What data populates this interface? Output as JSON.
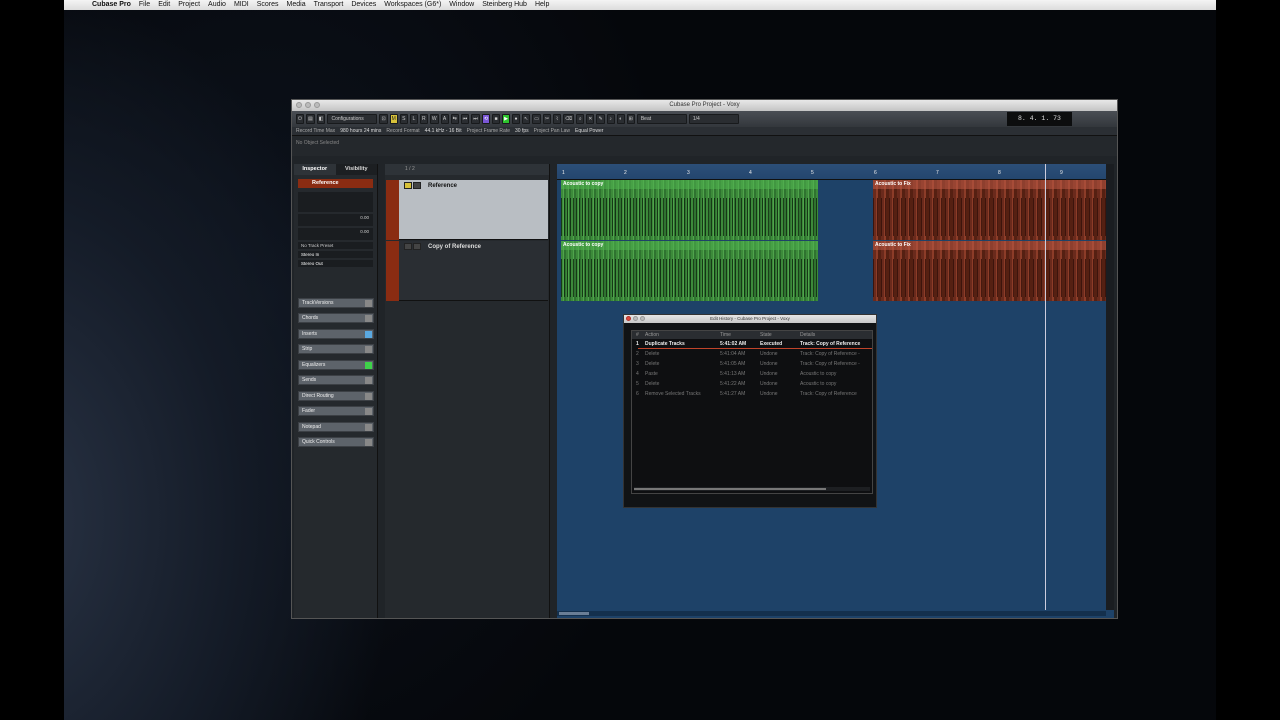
{
  "menubar": {
    "app": "Cubase Pro",
    "items": [
      "File",
      "Edit",
      "Project",
      "Audio",
      "MIDI",
      "Scores",
      "Media",
      "Transport",
      "Devices",
      "Workspaces (G6*)",
      "Window",
      "Steinberg Hub",
      "Help"
    ]
  },
  "window": {
    "title": "Cubase Pro Project - Voxy"
  },
  "toolbar": {
    "configurations": "Configurations",
    "m": "M",
    "s": "S",
    "l": "L",
    "r": "R",
    "w": "W",
    "a": "A",
    "snap": "Beat",
    "quantize": "1/4",
    "counter": "8. 4. 1. 73"
  },
  "infoline": {
    "rec_time_label": "Record Time Max",
    "rec_time_value": "980 hours 24 mins",
    "rec_format_label": "Record Format",
    "rec_format_value": "44.1 kHz - 16 Bit",
    "frame_rate_label": "Project Frame Rate",
    "frame_rate_value": "30 fps",
    "pan_law_label": "Project Pan Law",
    "pan_law_value": "Equal Power"
  },
  "no_object": "No Object Selected",
  "inspector": {
    "tabs": [
      "Inspector",
      "Visibility"
    ],
    "track_name": "Reference",
    "vol_value": "0.00",
    "pan_value": "0.00",
    "preset": "No Track Preset",
    "input": "Stereo In",
    "output": "Stereo Out",
    "sections": [
      "TrackVersions",
      "Chords",
      "Inserts",
      "Strip",
      "Equalizers",
      "Sends",
      "Direct Routing",
      "Fader",
      "Notepad",
      "Quick Controls"
    ]
  },
  "tracklist": {
    "header": "1 / 2",
    "tracks": [
      "Reference",
      "Copy of Reference"
    ]
  },
  "ruler": [
    "1",
    "2",
    "3",
    "4",
    "5",
    "6",
    "7",
    "8",
    "9"
  ],
  "clips": {
    "g1": "Acoustic to copy",
    "g2": "Acoustic to copy",
    "r1": "Acoustic to Fix",
    "r2": "Acoustic to Fix"
  },
  "history": {
    "title": "Edit History - Cubase Pro Project - Voxy",
    "columns": [
      "#",
      "Action",
      "Time",
      "State",
      "Details"
    ],
    "rows": [
      {
        "n": "1",
        "action": "Duplicate Tracks",
        "time": "5:41:02 AM",
        "state": "Executed",
        "details": "Track: Copy of Reference"
      },
      {
        "n": "2",
        "action": "Delete",
        "time": "5:41:04 AM",
        "state": "Undone",
        "details": "Track: Copy of Reference -"
      },
      {
        "n": "3",
        "action": "Delete",
        "time": "5:41:05 AM",
        "state": "Undone",
        "details": "Track: Copy of Reference -"
      },
      {
        "n": "4",
        "action": "Paste",
        "time": "5:41:13 AM",
        "state": "Undone",
        "details": "Acoustic to copy"
      },
      {
        "n": "5",
        "action": "Delete",
        "time": "5:41:22 AM",
        "state": "Undone",
        "details": "Acoustic to copy"
      },
      {
        "n": "6",
        "action": "Remove Selected Tracks",
        "time": "5:41:27 AM",
        "state": "Undone",
        "details": "Track: Copy of Reference"
      }
    ]
  }
}
